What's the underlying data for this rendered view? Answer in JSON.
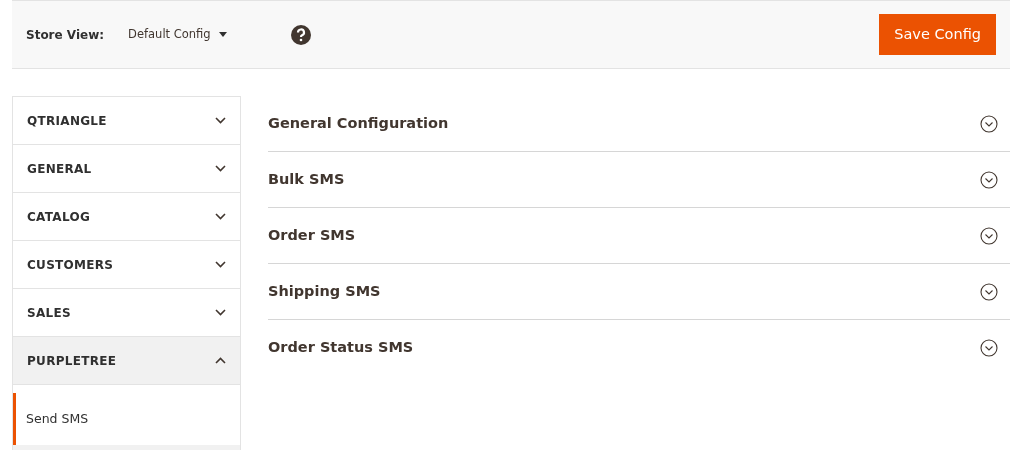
{
  "toolbar": {
    "store_view_label": "Store View:",
    "store_view_value": "Default Config",
    "save_button": "Save Config"
  },
  "sidebar": {
    "items": [
      {
        "label": "QTRIANGLE",
        "expanded": false
      },
      {
        "label": "GENERAL",
        "expanded": false
      },
      {
        "label": "CATALOG",
        "expanded": false
      },
      {
        "label": "CUSTOMERS",
        "expanded": false
      },
      {
        "label": "SALES",
        "expanded": false
      },
      {
        "label": "PURPLETREE",
        "expanded": true,
        "children": [
          {
            "label": "Send SMS",
            "selected": true
          }
        ]
      }
    ]
  },
  "sections": [
    {
      "title": "General Configuration",
      "expanded": false
    },
    {
      "title": "Bulk SMS",
      "expanded": false
    },
    {
      "title": "Order SMS",
      "expanded": false
    },
    {
      "title": "Shipping SMS",
      "expanded": false
    },
    {
      "title": "Order Status SMS",
      "expanded": false
    }
  ]
}
